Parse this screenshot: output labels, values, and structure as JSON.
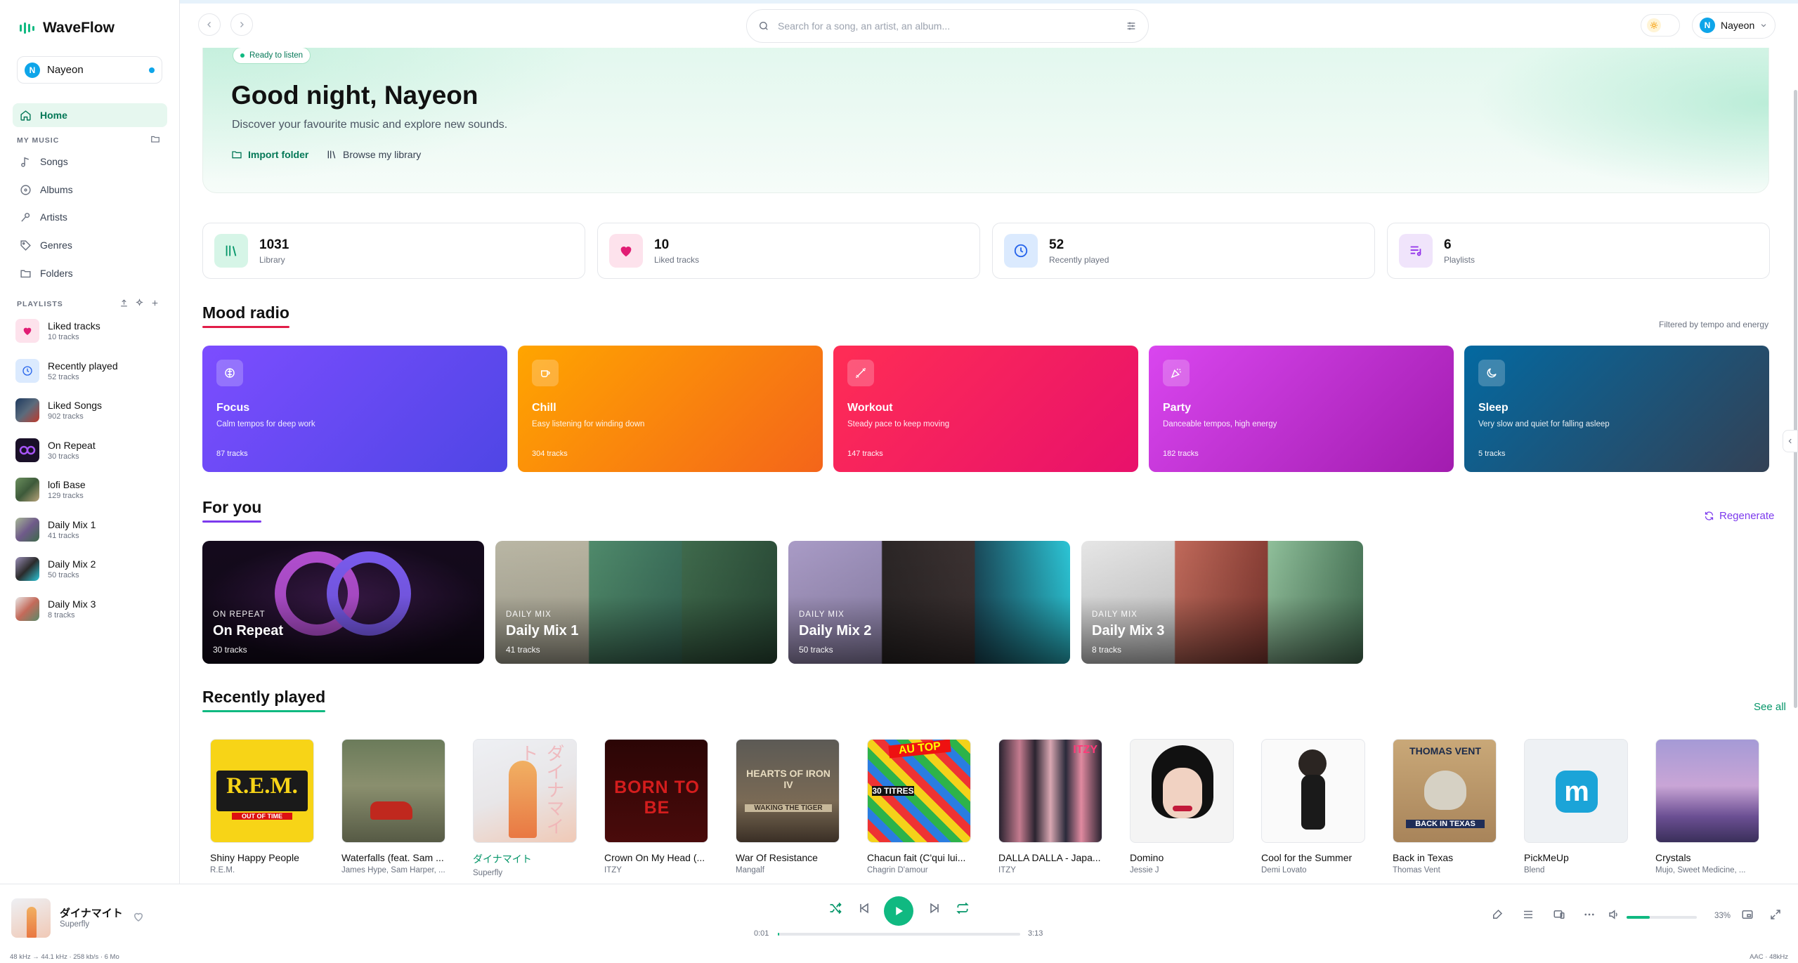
{
  "app": {
    "name": "WaveFlow"
  },
  "user": {
    "name": "Nayeon",
    "initial": "N"
  },
  "sidebar": {
    "home_label": "Home",
    "my_music_label": "MY MUSIC",
    "nav": [
      {
        "label": "Songs",
        "icon": "music-note-icon"
      },
      {
        "label": "Albums",
        "icon": "disc-icon"
      },
      {
        "label": "Artists",
        "icon": "microphone-icon"
      },
      {
        "label": "Genres",
        "icon": "tag-icon"
      },
      {
        "label": "Folders",
        "icon": "folder-icon"
      }
    ],
    "playlists_label": "PLAYLISTS",
    "playlists": [
      {
        "name": "Liked tracks",
        "count": "10 tracks"
      },
      {
        "name": "Recently played",
        "count": "52 tracks"
      },
      {
        "name": "Liked Songs",
        "count": "902 tracks"
      },
      {
        "name": "On Repeat",
        "count": "30 tracks"
      },
      {
        "name": "lofi Base",
        "count": "129 tracks"
      },
      {
        "name": "Daily Mix 1",
        "count": "41 tracks"
      },
      {
        "name": "Daily Mix 2",
        "count": "50 tracks"
      },
      {
        "name": "Daily Mix 3",
        "count": "8 tracks"
      }
    ]
  },
  "search": {
    "placeholder": "Search for a song, an artist, an album..."
  },
  "hero": {
    "badge": "Ready to listen",
    "title": "Good night, Nayeon",
    "subtitle": "Discover your favourite music and explore new sounds.",
    "import_label": "Import folder",
    "browse_label": "Browse my library"
  },
  "stats": [
    {
      "value": "1031",
      "label": "Library"
    },
    {
      "value": "10",
      "label": "Liked tracks"
    },
    {
      "value": "52",
      "label": "Recently played"
    },
    {
      "value": "6",
      "label": "Playlists"
    }
  ],
  "mood": {
    "title": "Mood radio",
    "note": "Filtered by tempo and energy",
    "cards": [
      {
        "name": "Focus",
        "desc": "Calm tempos for deep work",
        "count": "87 tracks",
        "color1": "#7c4dff",
        "color2": "#4f46e5"
      },
      {
        "name": "Chill",
        "desc": "Easy listening for winding down",
        "count": "304 tracks",
        "color1": "#ffa500",
        "color2": "#f4651a"
      },
      {
        "name": "Workout",
        "desc": "Steady pace to keep moving",
        "count": "147 tracks",
        "color1": "#ff2d55",
        "color2": "#e8116b"
      },
      {
        "name": "Party",
        "desc": "Danceable tempos, high energy",
        "count": "182 tracks",
        "color1": "#d946ef",
        "color2": "#a21caf"
      },
      {
        "name": "Sleep",
        "desc": "Very slow and quiet for falling asleep",
        "count": "5 tracks",
        "color1": "#0369a1",
        "color2": "#334155"
      }
    ]
  },
  "for_you": {
    "title": "For you",
    "regenerate": "Regenerate",
    "cards": [
      {
        "tag": "ON REPEAT",
        "name": "On Repeat",
        "count": "30 tracks"
      },
      {
        "tag": "DAILY MIX",
        "name": "Daily Mix 1",
        "count": "41 tracks"
      },
      {
        "tag": "DAILY MIX",
        "name": "Daily Mix 2",
        "count": "50 tracks"
      },
      {
        "tag": "DAILY MIX",
        "name": "Daily Mix 3",
        "count": "8 tracks"
      }
    ]
  },
  "recent": {
    "title": "Recently played",
    "see_all": "See all",
    "items": [
      {
        "title": "Shiny Happy People",
        "artist": "R.E.M.",
        "art_text": "R.E.M.",
        "art_sub": "OUT OF TIME"
      },
      {
        "title": "Waterfalls (feat. Sam ...",
        "artist": "James Hype, Sam Harper, ..."
      },
      {
        "title": "ダイナマイト",
        "artist": "Superfly",
        "art_text": "ダイナマイト"
      },
      {
        "title": "Crown On My Head (...",
        "artist": "ITZY",
        "art_text": "BORN TO BE"
      },
      {
        "title": "War Of Resistance",
        "artist": "Mangalf",
        "art_text": "HEARTS OF IRON IV",
        "art_sub": "WAKING THE TIGER"
      },
      {
        "title": "Chacun fait (C'qui lui...",
        "artist": "Chagrin D'amour",
        "art_text": "AU TOP",
        "art_sub": "30 TITRES"
      },
      {
        "title": "DALLA DALLA - Japa...",
        "artist": "ITZY",
        "art_text": "ITZY"
      },
      {
        "title": "Domino",
        "artist": "Jessie J"
      },
      {
        "title": "Cool for the Summer",
        "artist": "Demi Lovato"
      },
      {
        "title": "Back in Texas",
        "artist": "Thomas Vent",
        "art_text": "THOMAS VENT",
        "art_sub": "BACK IN TEXAS"
      },
      {
        "title": "PickMeUp",
        "artist": "Blend"
      },
      {
        "title": "Crystals",
        "artist": "Mujo, Sweet Medicine, ..."
      }
    ]
  },
  "player": {
    "title": "ダイナマイト",
    "artist": "Superfly",
    "current": "0:01",
    "total": "3:13",
    "progress": 0.005,
    "volume_label": "33%",
    "volume": 0.33
  },
  "status": {
    "left": "48 kHz → 44.1 kHz · 258 kb/s · 6 Mo",
    "right": "AAC · 48kHz"
  },
  "colors": {
    "accent": "#10b981",
    "accent_dark": "#047857",
    "purple": "#7c3aed",
    "mood_underline": "#e11d48"
  }
}
